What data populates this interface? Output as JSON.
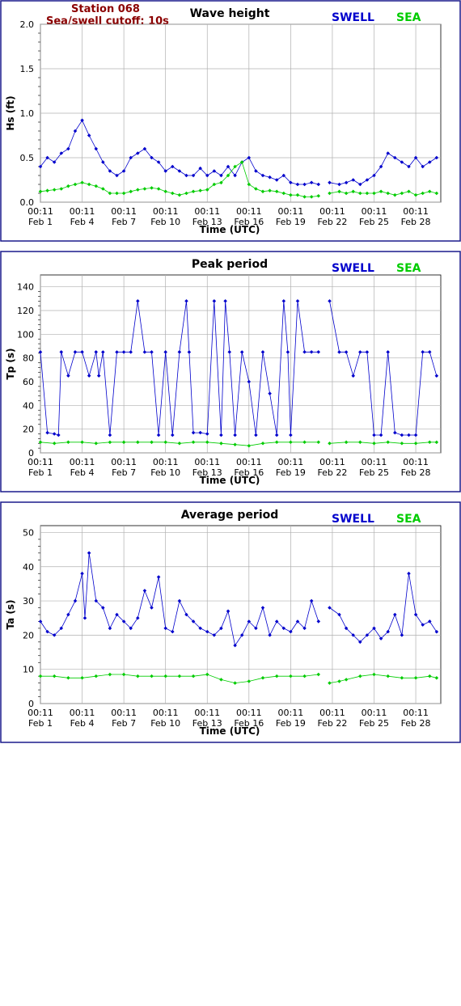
{
  "station": {
    "name": "Station 068",
    "cutoff": "Sea/swell cutoff: 10s"
  },
  "colors": {
    "swell": "#0000cc",
    "sea": "#00cc00",
    "frame": "#1a1a8c",
    "grid": "#b0b0b0",
    "station": "#8b0000"
  },
  "chart_data": [
    {
      "type": "line",
      "title": "Wave height",
      "xlabel": "Time (UTC)",
      "ylabel": "Hs (ft)",
      "ylim": [
        0,
        2.0
      ],
      "yticks": [
        0.0,
        0.5,
        1.0,
        1.5,
        2.0
      ],
      "ytick_labels": [
        "0.0",
        "0.5",
        "1.0",
        "1.5",
        "2.0"
      ],
      "xlim": [
        0,
        28.8
      ],
      "xticks": [
        0,
        3,
        6,
        9,
        12,
        15,
        18,
        21,
        24,
        27
      ],
      "xtick_labels": [
        [
          "00:11",
          "Feb 1"
        ],
        [
          "00:11",
          "Feb 4"
        ],
        [
          "00:11",
          "Feb 7"
        ],
        [
          "00:11",
          "Feb 10"
        ],
        [
          "00:11",
          "Feb 13"
        ],
        [
          "00:11",
          "Feb 16"
        ],
        [
          "00:11",
          "Feb 19"
        ],
        [
          "00:11",
          "Feb 22"
        ],
        [
          "00:11",
          "Feb 25"
        ],
        [
          "00:11",
          "Feb 28"
        ]
      ],
      "grid": true,
      "legend": [
        {
          "name": "SWELL",
          "color": "#0000cc"
        },
        {
          "name": "SEA",
          "color": "#00cc00"
        }
      ],
      "series": [
        {
          "name": "SWELL",
          "color": "#0000cc",
          "x": [
            0,
            0.5,
            1,
            1.5,
            2,
            2.5,
            3,
            3.5,
            4,
            4.5,
            5,
            5.5,
            6,
            6.5,
            7,
            7.5,
            8,
            8.5,
            9,
            9.5,
            10,
            10.5,
            11,
            11.5,
            12,
            12.5,
            13,
            13.5,
            14,
            14.5,
            15,
            15.5,
            16,
            16.5,
            17,
            17.5,
            18,
            18.5,
            19,
            19.5,
            20,
            null,
            20.8,
            21.5,
            22,
            22.5,
            23,
            23.5,
            24,
            24.5,
            25,
            25.5,
            26,
            26.5,
            27,
            27.5,
            28,
            28.5
          ],
          "y": [
            0.4,
            0.5,
            0.45,
            0.55,
            0.6,
            0.8,
            0.92,
            0.75,
            0.6,
            0.45,
            0.35,
            0.3,
            0.35,
            0.5,
            0.55,
            0.6,
            0.5,
            0.45,
            0.35,
            0.4,
            0.35,
            0.3,
            0.3,
            0.38,
            0.3,
            0.35,
            0.3,
            0.4,
            0.3,
            0.45,
            0.5,
            0.35,
            0.3,
            0.28,
            0.25,
            0.3,
            0.22,
            0.2,
            0.2,
            0.22,
            0.2,
            null,
            0.22,
            0.2,
            0.22,
            0.25,
            0.2,
            0.25,
            0.3,
            0.4,
            0.55,
            0.5,
            0.45,
            0.4,
            0.5,
            0.4,
            0.45,
            0.5
          ]
        },
        {
          "name": "SEA",
          "color": "#00cc00",
          "x": [
            0,
            0.5,
            1,
            1.5,
            2,
            2.5,
            3,
            3.5,
            4,
            4.5,
            5,
            5.5,
            6,
            6.5,
            7,
            7.5,
            8,
            8.5,
            9,
            9.5,
            10,
            10.5,
            11,
            11.5,
            12,
            12.5,
            13,
            13.5,
            14,
            14.5,
            15,
            15.5,
            16,
            16.5,
            17,
            17.5,
            18,
            18.5,
            19,
            19.5,
            20,
            null,
            20.8,
            21.5,
            22,
            22.5,
            23,
            23.5,
            24,
            24.5,
            25,
            25.5,
            26,
            26.5,
            27,
            27.5,
            28,
            28.5
          ],
          "y": [
            0.12,
            0.13,
            0.14,
            0.15,
            0.18,
            0.2,
            0.22,
            0.2,
            0.18,
            0.15,
            0.1,
            0.1,
            0.1,
            0.12,
            0.14,
            0.15,
            0.16,
            0.15,
            0.12,
            0.1,
            0.08,
            0.1,
            0.12,
            0.13,
            0.14,
            0.2,
            0.22,
            0.3,
            0.4,
            0.45,
            0.2,
            0.15,
            0.12,
            0.13,
            0.12,
            0.1,
            0.08,
            0.08,
            0.06,
            0.06,
            0.07,
            null,
            0.1,
            0.12,
            0.1,
            0.12,
            0.1,
            0.1,
            0.1,
            0.12,
            0.1,
            0.08,
            0.1,
            0.12,
            0.08,
            0.1,
            0.12,
            0.1
          ]
        }
      ]
    },
    {
      "type": "line",
      "title": "Peak period",
      "xlabel": "Time (UTC)",
      "ylabel": "Tp (s)",
      "ylim": [
        0,
        150
      ],
      "yticks": [
        0,
        20,
        40,
        60,
        80,
        100,
        120,
        140
      ],
      "ytick_labels": [
        "0",
        "20",
        "40",
        "60",
        "80",
        "100",
        "120",
        "140"
      ],
      "xlim": [
        0,
        28.8
      ],
      "xticks": [
        0,
        3,
        6,
        9,
        12,
        15,
        18,
        21,
        24,
        27
      ],
      "xtick_labels": [
        [
          "00:11",
          "Feb 1"
        ],
        [
          "00:11",
          "Feb 4"
        ],
        [
          "00:11",
          "Feb 7"
        ],
        [
          "00:11",
          "Feb 10"
        ],
        [
          "00:11",
          "Feb 13"
        ],
        [
          "00:11",
          "Feb 16"
        ],
        [
          "00:11",
          "Feb 19"
        ],
        [
          "00:11",
          "Feb 22"
        ],
        [
          "00:11",
          "Feb 25"
        ],
        [
          "00:11",
          "Feb 28"
        ]
      ],
      "grid": true,
      "legend": [
        {
          "name": "SWELL",
          "color": "#0000cc"
        },
        {
          "name": "SEA",
          "color": "#00cc00"
        }
      ],
      "series": [
        {
          "name": "SWELL",
          "color": "#0000cc",
          "x": [
            0,
            0.5,
            1,
            1.3,
            1.5,
            2,
            2.5,
            3,
            3.5,
            4,
            4.2,
            4.5,
            5,
            5.5,
            6,
            6.5,
            7,
            7.5,
            8,
            8.5,
            9,
            9.5,
            10,
            10.5,
            10.7,
            11,
            11.5,
            12,
            12.5,
            13,
            13.3,
            13.6,
            14,
            14.5,
            15,
            15.5,
            16,
            16.5,
            17,
            17.5,
            17.8,
            18,
            18.5,
            19,
            19.5,
            20,
            null,
            20.8,
            21.5,
            22,
            22.5,
            23,
            23.5,
            24,
            24.5,
            25,
            25.5,
            26,
            26.5,
            27,
            27.5,
            28,
            28.5
          ],
          "y": [
            85,
            17,
            16,
            15,
            85,
            65,
            85,
            85,
            65,
            85,
            65,
            85,
            15,
            85,
            85,
            85,
            128,
            85,
            85,
            15,
            85,
            15,
            85,
            128,
            85,
            17,
            17,
            16,
            128,
            15,
            128,
            85,
            15,
            85,
            60,
            15,
            85,
            50,
            15,
            128,
            85,
            15,
            128,
            85,
            85,
            85,
            null,
            128,
            85,
            85,
            65,
            85,
            85,
            15,
            15,
            85,
            17,
            15,
            15,
            15,
            85,
            85,
            65
          ]
        },
        {
          "name": "SEA",
          "color": "#00cc00",
          "x": [
            0,
            1,
            2,
            3,
            4,
            5,
            6,
            7,
            8,
            9,
            10,
            11,
            12,
            13,
            14,
            15,
            16,
            17,
            18,
            19,
            20,
            null,
            20.8,
            22,
            23,
            24,
            25,
            26,
            27,
            28,
            28.5
          ],
          "y": [
            9,
            8,
            9,
            9,
            8,
            9,
            9,
            9,
            9,
            9,
            8,
            9,
            9,
            8,
            7,
            6,
            8,
            9,
            9,
            9,
            9,
            null,
            8,
            9,
            9,
            8,
            9,
            8,
            8,
            9,
            9
          ]
        }
      ]
    },
    {
      "type": "line",
      "title": "Average period",
      "xlabel": "Time (UTC)",
      "ylabel": "Ta (s)",
      "ylim": [
        0,
        52
      ],
      "yticks": [
        0,
        10,
        20,
        30,
        40,
        50
      ],
      "ytick_labels": [
        "0",
        "10",
        "20",
        "30",
        "40",
        "50"
      ],
      "xlim": [
        0,
        28.8
      ],
      "xticks": [
        0,
        3,
        6,
        9,
        12,
        15,
        18,
        21,
        24,
        27
      ],
      "xtick_labels": [
        [
          "00:11",
          "Feb 1"
        ],
        [
          "00:11",
          "Feb 4"
        ],
        [
          "00:11",
          "Feb 7"
        ],
        [
          "00:11",
          "Feb 10"
        ],
        [
          "00:11",
          "Feb 13"
        ],
        [
          "00:11",
          "Feb 16"
        ],
        [
          "00:11",
          "Feb 19"
        ],
        [
          "00:11",
          "Feb 22"
        ],
        [
          "00:11",
          "Feb 25"
        ],
        [
          "00:11",
          "Feb 28"
        ]
      ],
      "grid": true,
      "legend": [
        {
          "name": "SWELL",
          "color": "#0000cc"
        },
        {
          "name": "SEA",
          "color": "#00cc00"
        }
      ],
      "series": [
        {
          "name": "SWELL",
          "color": "#0000cc",
          "x": [
            0,
            0.5,
            1,
            1.5,
            2,
            2.5,
            3,
            3.2,
            3.5,
            4,
            4.5,
            5,
            5.5,
            6,
            6.5,
            7,
            7.5,
            8,
            8.5,
            9,
            9.5,
            10,
            10.5,
            11,
            11.5,
            12,
            12.5,
            13,
            13.5,
            14,
            14.5,
            15,
            15.5,
            16,
            16.5,
            17,
            17.5,
            18,
            18.5,
            19,
            19.5,
            20,
            null,
            20.8,
            21.5,
            22,
            22.5,
            23,
            23.5,
            24,
            24.5,
            25,
            25.5,
            26,
            26.5,
            27,
            27.5,
            28,
            28.5
          ],
          "y": [
            24,
            21,
            20,
            22,
            26,
            30,
            38,
            25,
            44,
            30,
            28,
            22,
            26,
            24,
            22,
            25,
            33,
            28,
            37,
            22,
            21,
            30,
            26,
            24,
            22,
            21,
            20,
            22,
            27,
            17,
            20,
            24,
            22,
            28,
            20,
            24,
            22,
            21,
            24,
            22,
            30,
            24,
            null,
            28,
            26,
            22,
            20,
            18,
            20,
            22,
            19,
            21,
            26,
            20,
            38,
            26,
            23,
            24,
            21
          ]
        },
        {
          "name": "SEA",
          "color": "#00cc00",
          "x": [
            0,
            1,
            2,
            3,
            4,
            5,
            6,
            7,
            8,
            9,
            10,
            11,
            12,
            13,
            14,
            15,
            16,
            17,
            18,
            19,
            20,
            null,
            20.8,
            21.5,
            22,
            23,
            24,
            25,
            26,
            27,
            28,
            28.5
          ],
          "y": [
            8,
            8,
            7.5,
            7.5,
            8,
            8.5,
            8.5,
            8,
            8,
            8,
            8,
            8,
            8.5,
            7,
            6,
            6.5,
            7.5,
            8,
            8,
            8,
            8.5,
            null,
            6,
            6.5,
            7,
            8,
            8.5,
            8,
            7.5,
            7.5,
            8,
            7.5
          ]
        }
      ]
    }
  ]
}
